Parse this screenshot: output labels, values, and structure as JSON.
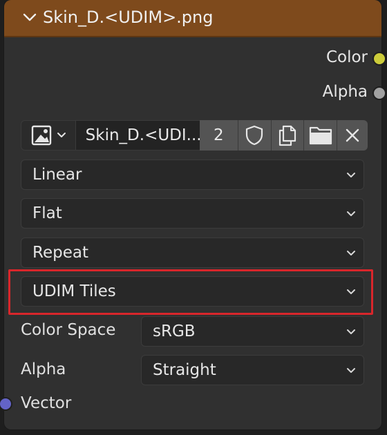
{
  "header": {
    "title": "Skin_D.<UDIM>.png"
  },
  "outputs": [
    {
      "label": "Color",
      "socket_color": "#cccc3a"
    },
    {
      "label": "Alpha",
      "socket_color": "#a1a1a1"
    }
  ],
  "image_bar": {
    "image_name": "Skin_D.<UDI...",
    "users_count": "2"
  },
  "dropdowns": {
    "interpolation": "Linear",
    "projection": "Flat",
    "extension": "Repeat",
    "source": "UDIM Tiles"
  },
  "color_space": {
    "label": "Color Space",
    "value": "sRGB"
  },
  "alpha_mode": {
    "label": "Alpha",
    "value": "Straight"
  },
  "inputs": [
    {
      "label": "Vector",
      "socket_color": "#6363c7"
    }
  ],
  "colors": {
    "header": "#7e4a1c",
    "node_body": "#303030",
    "highlight": "#d9262b"
  }
}
